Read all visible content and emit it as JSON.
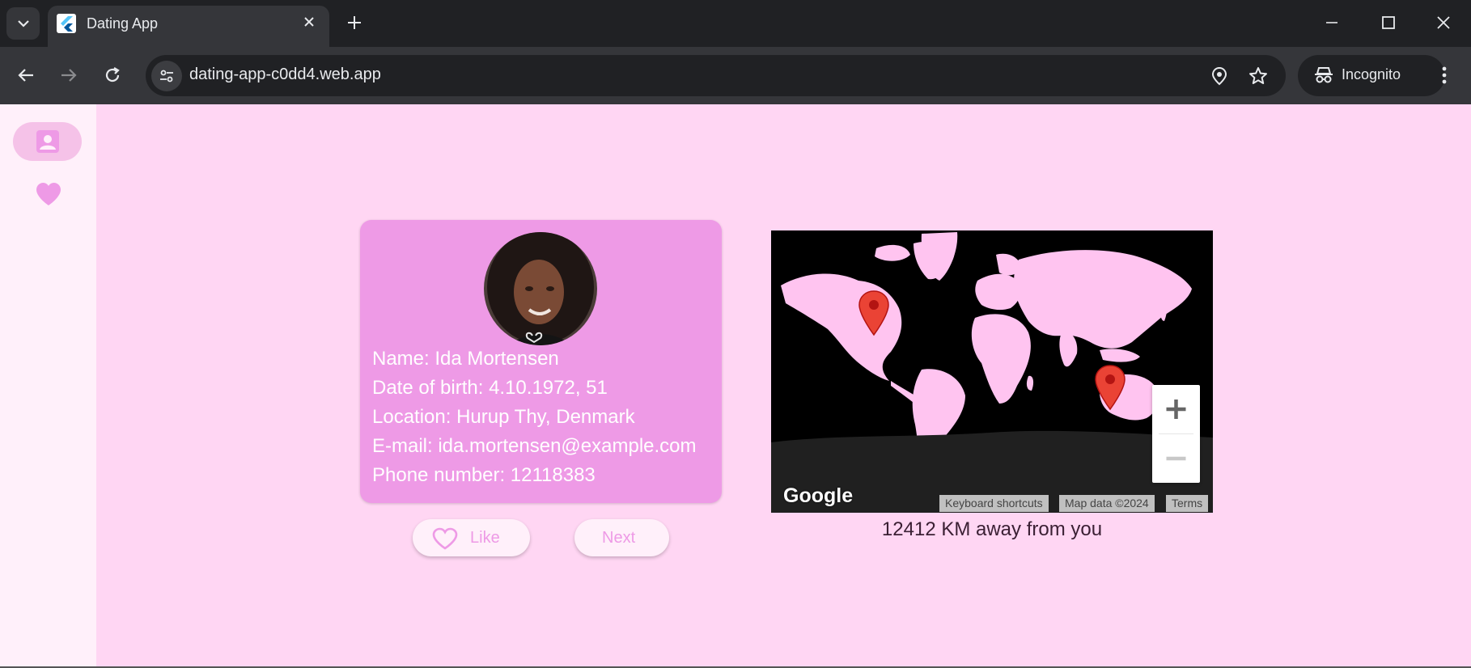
{
  "browser": {
    "tab_title": "Dating App",
    "url": "dating-app-c0dd4.web.app",
    "incognito_label": "Incognito"
  },
  "sidebar": {
    "items": [
      {
        "name": "profile",
        "icon": "person-badge-icon",
        "selected": true
      },
      {
        "name": "favorites",
        "icon": "heart-icon",
        "selected": false
      }
    ]
  },
  "profile": {
    "name_line": "Name: Ida Mortensen",
    "dob_line": "Date of birth: 4.10.1972, 51",
    "location_line": "Location: Hurup Thy, Denmark",
    "email_line": "E-mail: ida.mortensen@example.com",
    "phone_line": "Phone number: 12118383"
  },
  "actions": {
    "like_label": "Like",
    "next_label": "Next"
  },
  "map": {
    "logo": "Google",
    "keyboard_shortcuts": "Keyboard shortcuts",
    "map_data": "Map data ©2024",
    "terms": "Terms",
    "markers": [
      {
        "label": "you",
        "lat": 37.4,
        "lng": -122.1
      },
      {
        "label": "match",
        "lat": -31.9,
        "lng": 115.9
      }
    ]
  },
  "distance_text": "12412 KM away from you",
  "colors": {
    "background": "#ffd6f3",
    "sidebar": "#fff0fa",
    "accent": "#ee9ae6",
    "land": "#ffc4f0",
    "marker": "#ea4335"
  }
}
